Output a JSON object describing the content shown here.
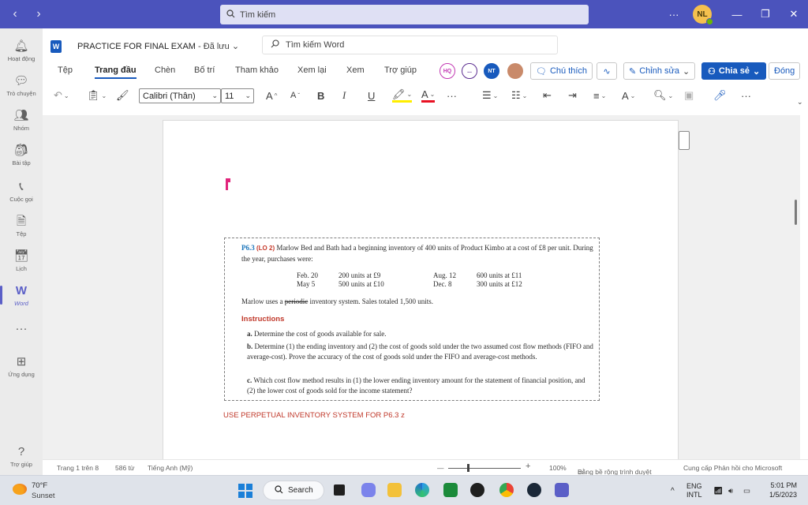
{
  "titlebar": {
    "back_glyph": "‹",
    "forward_glyph": "›",
    "search_placeholder": "Tìm kiếm",
    "more": "···",
    "avatar": "NL",
    "min_glyph": "—",
    "max_glyph": "❐",
    "close_glyph": "✕",
    "bg": "#4b53bc"
  },
  "rail": [
    {
      "icon": "bell-icon",
      "glyph": "🔔︎",
      "label": "Hoạt động"
    },
    {
      "icon": "chat-icon",
      "glyph": "💬︎",
      "label": "Trò chuyện"
    },
    {
      "icon": "teams-icon",
      "glyph": "👥︎",
      "label": "Nhóm"
    },
    {
      "icon": "assignments-icon",
      "glyph": "🎒︎",
      "label": "Bài tập"
    },
    {
      "icon": "phone-icon",
      "glyph": "📞︎",
      "label": "Cuộc gọi"
    },
    {
      "icon": "file-icon",
      "glyph": "🗎",
      "label": "Tệp"
    },
    {
      "icon": "calendar-icon",
      "glyph": "📅︎",
      "label": "Lịch"
    },
    {
      "icon": "word-icon",
      "glyph": "W",
      "label": "Word"
    },
    {
      "icon": "more-apps-icon",
      "glyph": "···",
      "label": ""
    },
    {
      "icon": "apps-icon",
      "glyph": "⊞",
      "label": "Ứng dụng"
    },
    {
      "icon": "help-icon",
      "glyph": "?",
      "label": "Trợ giúp"
    }
  ],
  "word": {
    "logo": "W",
    "doc_title": "PRACTICE FOR FINAL EXAM",
    "saved": "Đã lưu",
    "search_placeholder": "Tìm kiếm Word",
    "tabs": [
      "Tệp",
      "Trang đầu",
      "Chèn",
      "Bố trí",
      "Tham khảo",
      "Xem lại",
      "Xem",
      "Trợ giúp"
    ],
    "presence": [
      "HQ",
      "...",
      "NT"
    ],
    "comments_btn": "Chú thích",
    "editing_btn": "Chỉnh sửa",
    "share_btn": "Chia sẻ",
    "close_btn": "Đóng",
    "font_name": "Calibri (Thân)",
    "font_size": "11",
    "ribbon_glyphs": {
      "undo": "↶",
      "paste": "📋︎",
      "painter": "🖌︎",
      "grow": "A",
      "shrink": "A",
      "bold": "B",
      "italic": "I",
      "underline": "U",
      "highlight": "🖍︎",
      "color": "A",
      "more": "···",
      "bullets": "☰",
      "numbering": "☷",
      "outdent": "⇤",
      "indent": "⇥",
      "align": "≡",
      "styles": "A",
      "find": "🔍︎",
      "designer": "▣",
      "dictate": "🎤︎"
    }
  },
  "document": {
    "problem_id": "P6.3",
    "problem_lo": "(LO 2)",
    "problem_intro": "Marlow Bed and Bath had a beginning inventory of 400 units of Product Kimbo at a cost of £8 per unit. During the year, purchases were:",
    "purchases": [
      {
        "date": "Feb. 20",
        "detail": "200 units at £9"
      },
      {
        "date": "May 5",
        "detail": "500 units at £10"
      },
      {
        "date": "Aug. 12",
        "detail": "600 units at £11"
      },
      {
        "date": "Dec. 8",
        "detail": "300 units at £12"
      }
    ],
    "system_pre": "Marlow uses a ",
    "system_strike": "periodic",
    "system_post": " inventory system. Sales totaled 1,500 units.",
    "instructions_heading": "Instructions",
    "instructions": [
      {
        "letter": "a.",
        "text": "Determine the cost of goods available for sale."
      },
      {
        "letter": "b.",
        "text": "Determine (1) the ending inventory and (2) the cost of goods sold under the two assumed cost flow methods (FIFO and average-cost). Prove the accuracy of the cost of goods sold under the FIFO and average-cost methods."
      },
      {
        "letter": "c.",
        "text": "Which cost flow method results in (1) the lower ending inventory amount for the statement of financial position, and (2) the lower cost of goods sold for the income statement?"
      }
    ],
    "note": "USE PERPETUAL INVENTORY SYSTEM FOR P6.3 z"
  },
  "status": {
    "page": "Trang 1 trên 8",
    "words": "586 từ",
    "language": "Tiếng Anh (Mỹ)",
    "zoom_minus": "—",
    "zoom_plus": "+",
    "zoom": "100%",
    "fit_width": "Bằng bề rộng trình duyệt",
    "feedback": "Cung cấp Phản hồi cho Microsoft"
  },
  "taskbar": {
    "temp": "70°F",
    "weather": "Sunset",
    "search": "Search",
    "lang1": "ENG",
    "lang2": "INTL",
    "time": "5:01 PM",
    "date": "1/5/2023"
  }
}
